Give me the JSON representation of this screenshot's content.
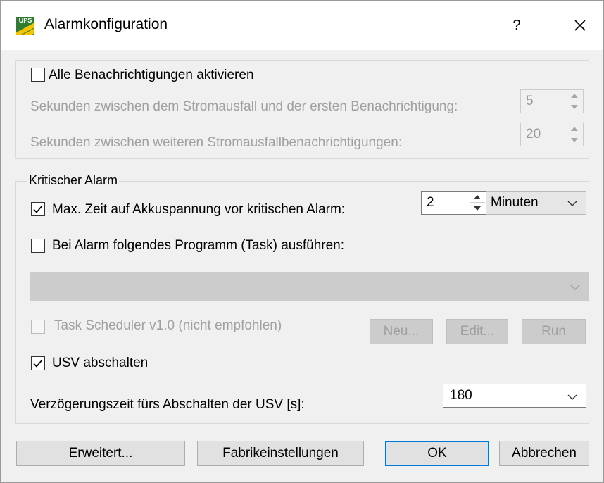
{
  "window": {
    "title": "Alarmkonfiguration",
    "app_icon_text": "UPS",
    "help_label": "?",
    "close_label": "✕"
  },
  "notifications": {
    "enable_all_label": "Alle Benachrichtigungen aktivieren",
    "enable_all_checked": false,
    "first_delay_label": "Sekunden zwischen dem Stromausfall und der ersten Benachrichtigung:",
    "first_delay_value": "5",
    "repeat_delay_label": "Sekunden zwischen weiteren Stromausfallbenachrichtigungen:",
    "repeat_delay_value": "20"
  },
  "critical": {
    "legend": "Kritischer Alarm",
    "max_time_label": "Max. Zeit auf Akkuspannung vor kritischen Alarm:",
    "max_time_checked": true,
    "max_time_value": "2",
    "max_time_unit": "Minuten",
    "run_program_label": "Bei Alarm folgendes Programm (Task) ausführen:",
    "run_program_checked": false,
    "program_value": "",
    "task_scheduler_label": "Task Scheduler v1.0 (nicht empfohlen)",
    "task_scheduler_checked": false,
    "new_label": "Neu...",
    "edit_label": "Edit...",
    "run_label": "Run",
    "shutdown_label": "USV abschalten",
    "shutdown_checked": true,
    "shutdown_delay_label": "Verzögerungszeit fürs Abschalten der USV [s]:",
    "shutdown_delay_value": "180"
  },
  "footer": {
    "advanced_label": "Erweitert...",
    "defaults_label": "Fabrikeinstellungen",
    "ok_label": "OK",
    "cancel_label": "Abbrechen"
  },
  "colors": {
    "accent": "#0078d7",
    "icon_green": "#2e7d32",
    "icon_yellow": "#f5c400",
    "disabled_text": "#a0a0a0"
  }
}
